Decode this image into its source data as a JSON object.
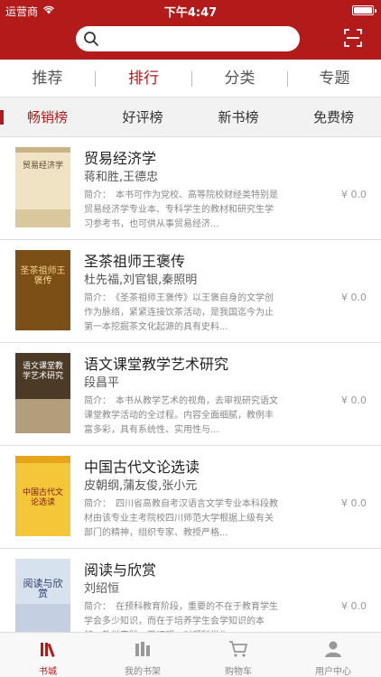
{
  "status_bar": {
    "carrier": "运营商",
    "time": "下午4:47"
  },
  "search": {
    "placeholder": ""
  },
  "tabs": [
    {
      "label": "推荐"
    },
    {
      "label": "排行"
    },
    {
      "label": "分类"
    },
    {
      "label": "专题"
    }
  ],
  "subtabs": [
    {
      "label": "畅销榜"
    },
    {
      "label": "好评榜"
    },
    {
      "label": "新书榜"
    },
    {
      "label": "免费榜"
    }
  ],
  "books": [
    {
      "title": "贸易经济学",
      "author": "蒋和胜,王德忠",
      "intro": "简介：　本书可作为党校、高等院校财经类特别是贸易经济学专业本、专科学生的教材和研究生学习参考书，也可供从事贸易经济...",
      "price": "¥ 0.0",
      "cover_text": "贸易经济学",
      "cover_bg": "#efe3c4",
      "cover_fg": "#5a4630"
    },
    {
      "title": "圣茶祖师王褒传",
      "author": "杜先福,刘官银,秦照明",
      "intro": "简介：　《圣茶祖师王褒传》以王褒自身的文学创作为脉络，紧紧连接饮茶活动，是我国迄今为止第一本挖掘茶文化起源的具有史料...",
      "price": "¥ 0.0",
      "cover_text": "圣茶祖师王褒传",
      "cover_bg": "#8a5a1c",
      "cover_fg": "#f3d28a"
    },
    {
      "title": "语文课堂教学艺术研究",
      "author": "段昌平",
      "intro": "简介：　本书从教学艺术的视角，去审视研究语文课堂教学活动的全过程。内容全面细腻，教例丰富多彩，具有系统性、实用性与...",
      "price": "¥ 0.0",
      "cover_text": "语文课堂教学艺术研究",
      "cover_bg": "#4a3a26",
      "cover_fg": "#ffffff"
    },
    {
      "title": "中国古代文论选读",
      "author": "皮朝纲,蒲友俊,张小元",
      "intro": "简介：　四川省高教自考汉语言文学专业本科段教材由该专业主考院校四川师范大学根据上级有关部门的精神，组织专家、教授严格...",
      "price": "¥ 0.0",
      "cover_text": "中国古代文论选读",
      "cover_bg": "#f4c73a",
      "cover_fg": "#7a1a10"
    },
    {
      "title": "阅读与欣赏",
      "author": "刘绍恒",
      "intro": "简介：　在预科教育阶段，重要的不在于教育学生学会多少知识，而在于培养学生会学知识的本领，教学实践一再证明，对预科学生...",
      "price": "¥ 0.0",
      "cover_text": "阅读与欣赏",
      "cover_bg": "#d8e2ef",
      "cover_fg": "#2a3a6a"
    }
  ],
  "bottom_nav": [
    {
      "label": "书城",
      "icon": "bookshelf-icon"
    },
    {
      "label": "我的书架",
      "icon": "books-icon"
    },
    {
      "label": "购物车",
      "icon": "cart-icon"
    },
    {
      "label": "用户中心",
      "icon": "user-icon"
    }
  ],
  "colors": {
    "brand": "#b31b1b"
  }
}
